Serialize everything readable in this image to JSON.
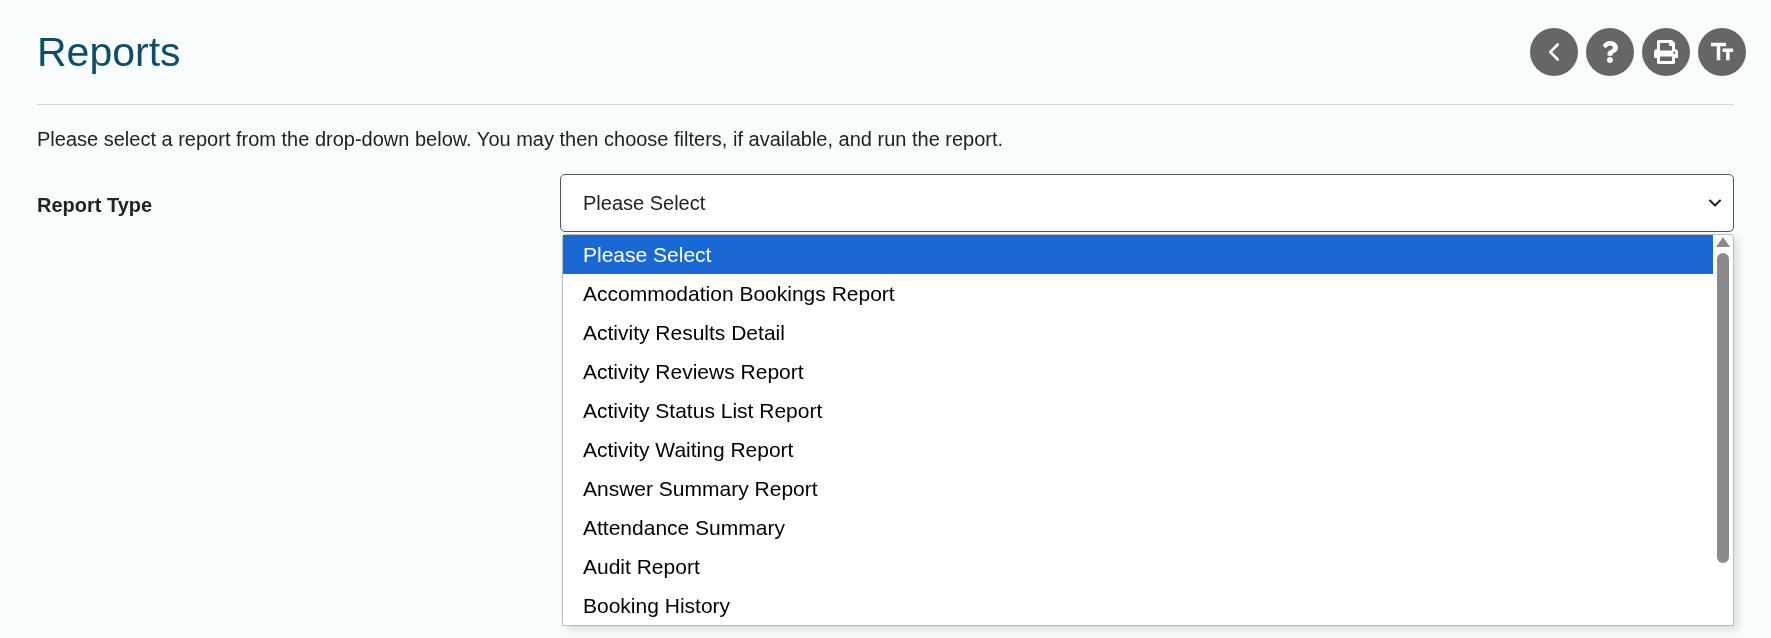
{
  "page": {
    "title": "Reports"
  },
  "intro": "Please select a report from the drop-down below. You may then choose filters, if available, and run the report.",
  "report_type": {
    "label": "Report Type",
    "value": "Please Select",
    "expanded": true,
    "options": [
      {
        "label": "Please Select",
        "selected": true
      },
      {
        "label": "Accommodation Bookings Report",
        "selected": false
      },
      {
        "label": "Activity Results Detail",
        "selected": false
      },
      {
        "label": "Activity Reviews Report",
        "selected": false
      },
      {
        "label": "Activity Status List Report",
        "selected": false
      },
      {
        "label": "Activity Waiting Report",
        "selected": false
      },
      {
        "label": "Answer Summary Report",
        "selected": false
      },
      {
        "label": "Attendance Summary",
        "selected": false
      },
      {
        "label": "Audit Report",
        "selected": false
      },
      {
        "label": "Booking History",
        "selected": false
      }
    ]
  }
}
